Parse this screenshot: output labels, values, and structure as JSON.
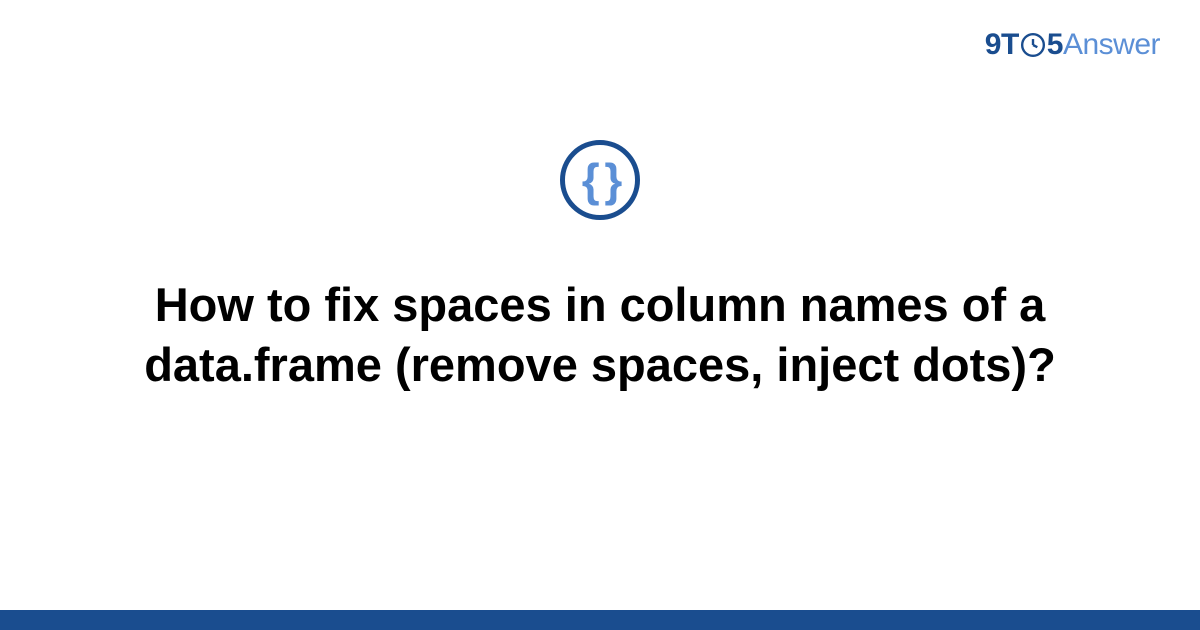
{
  "logo": {
    "nine": "9",
    "t": "T",
    "five": "5",
    "answer": "Answer"
  },
  "icon": {
    "name": "code-braces-icon",
    "glyph": "{ }"
  },
  "title": "How to fix spaces in column names of a data.frame (remove spaces, inject dots)?",
  "colors": {
    "brand_dark": "#1a4d8f",
    "brand_light": "#5b8fd6",
    "text": "#000000",
    "background": "#ffffff"
  }
}
